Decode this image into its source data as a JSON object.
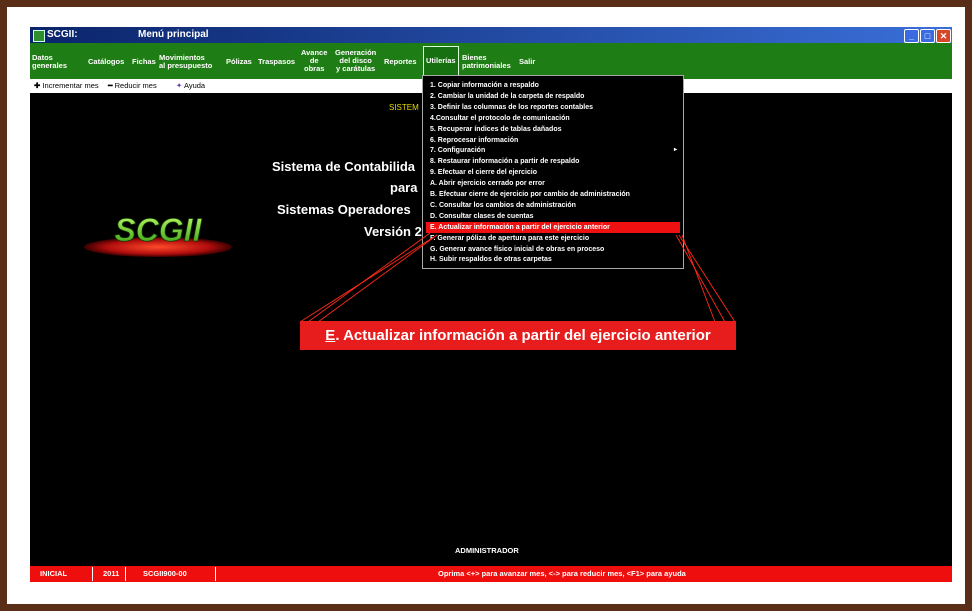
{
  "window": {
    "title": "SCGII:",
    "subtitle": "Menú principal",
    "controls": [
      "_",
      "□",
      "✕"
    ]
  },
  "menubar": {
    "items": [
      {
        "label": "Datos\ngenerales"
      },
      {
        "label": "Catálogos"
      },
      {
        "label": "Fichas"
      },
      {
        "label": "Movimientos\nal presupuesto"
      },
      {
        "label": "Pólizas"
      },
      {
        "label": "Traspasos"
      },
      {
        "label": "Avance\nde\nobras"
      },
      {
        "label": "Generación\ndel disco\ny carátulas"
      },
      {
        "label": "Reportes"
      },
      {
        "label": "Utilerías"
      },
      {
        "label": "Bienes\npatrimoniales"
      },
      {
        "label": "Salir"
      }
    ]
  },
  "toolbar": {
    "increment": "Incrementar mes",
    "decrement": "Reducir mes",
    "help": "Ayuda"
  },
  "main": {
    "heading_partial": "SISTEM",
    "line1": "Sistema de Contabilida",
    "line2": "para",
    "line3": "Sistemas Operadores",
    "line4": "Versión 2",
    "logo_text": "SCGII",
    "user": "ADMINISTRADOR"
  },
  "dropdown": {
    "items": [
      {
        "label": "1. Copiar información a respaldo"
      },
      {
        "label": "2. Cambiar la unidad de la carpeta de respaldo"
      },
      {
        "label": "3. Definir las columnas de los reportes contables"
      },
      {
        "label": "4.Consultar el protocolo de comunicación"
      },
      {
        "label": "5. Recuperar índices de tablas dañados"
      },
      {
        "label": "6. Reprocesar información"
      },
      {
        "label": "7. Configuración",
        "submenu": "▸"
      },
      {
        "label": "8. Restaurar información a partir de respaldo"
      },
      {
        "label": "9. Efectuar el cierre del ejercicio"
      },
      {
        "label": "A. Abrir ejercicio cerrado por error"
      },
      {
        "label": "B. Efectuar cierre de ejercicio por cambio de administración"
      },
      {
        "label": "C. Consultar los cambios de administración"
      },
      {
        "label": "D. Consultar clases de cuentas"
      },
      {
        "label": "E. Actualizar información a partir del ejercicio anterior",
        "highlighted": true
      },
      {
        "label": "F. Generar póliza de apertura para este ejercicio"
      },
      {
        "label": "G. Generar avance físico inicial de obras en proceso"
      },
      {
        "label": "H. Subir respaldos de otras carpetas"
      }
    ]
  },
  "callout": {
    "letter": "E",
    "text": ". Actualizar información a partir del ejercicio anterior"
  },
  "statusbar": {
    "mode": "INICIAL",
    "year": "2011",
    "code": "SCGII900-00",
    "hint": "Oprima <+> para avanzar mes, <-> para reducir mes, <F1> para ayuda"
  },
  "colors": {
    "menubar": "#1f7d15",
    "statusbar": "#ef0e0e",
    "highlight": "#ef1111",
    "frame": "#5a2d16",
    "heading_yellow": "#e8d800"
  }
}
